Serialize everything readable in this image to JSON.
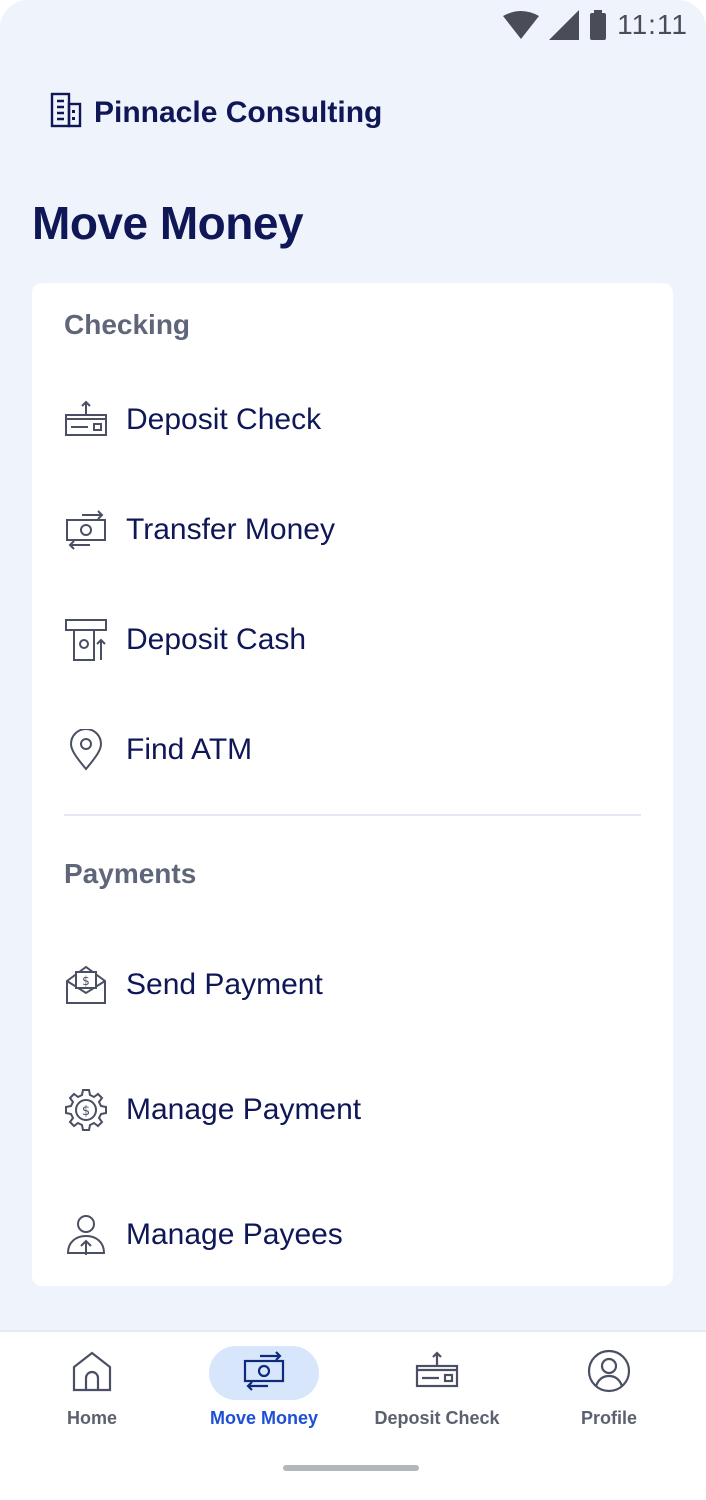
{
  "status_bar": {
    "time": "11:11",
    "icons": [
      "wifi-icon",
      "signal-icon",
      "battery-icon"
    ]
  },
  "brand": {
    "name": "Pinnacle Consulting",
    "icon": "building-icon"
  },
  "page": {
    "title": "Move Money"
  },
  "checking": {
    "heading": "Checking",
    "items": [
      {
        "label": "Deposit Check",
        "icon": "deposit-check-icon"
      },
      {
        "label": "Transfer Money",
        "icon": "transfer-money-icon"
      },
      {
        "label": "Deposit Cash",
        "icon": "deposit-cash-icon"
      },
      {
        "label": "Find ATM",
        "icon": "location-pin-icon"
      }
    ]
  },
  "payments": {
    "heading": "Payments",
    "items": [
      {
        "label": "Send Payment",
        "icon": "send-payment-icon"
      },
      {
        "label": "Manage Payment",
        "icon": "manage-payment-icon"
      },
      {
        "label": "Manage Payees",
        "icon": "manage-payees-icon"
      }
    ]
  },
  "bottom_nav": {
    "active": "Move Money",
    "items": [
      {
        "label": "Home",
        "icon": "home-icon"
      },
      {
        "label": "Move Money",
        "icon": "transfer-money-icon"
      },
      {
        "label": "Deposit Check",
        "icon": "deposit-check-icon"
      },
      {
        "label": "Profile",
        "icon": "profile-icon"
      }
    ]
  },
  "colors": {
    "background": "#eff3fb",
    "primary_text": "#0f1757",
    "section_heading": "#606679",
    "active_nav": "#1f4fd6",
    "active_nav_pill": "#d7e6fb"
  }
}
